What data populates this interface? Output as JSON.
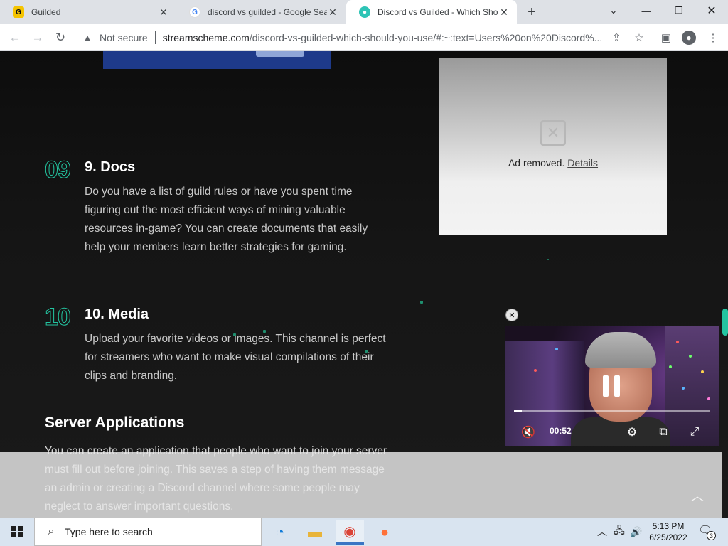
{
  "browser": {
    "tabs": [
      {
        "title": "Guilded",
        "favicon": "guilded-icon",
        "favicon_color": "#f5c400"
      },
      {
        "title": "discord vs guilded - Google Search",
        "favicon": "google-icon",
        "favicon_color": "#4285f4"
      },
      {
        "title": "Discord vs Guilded - Which Should You Use",
        "favicon": "streamscheme-icon",
        "favicon_color": "#2ec4b6",
        "active": true
      }
    ],
    "new_tab_label": "+",
    "security_label": "Not secure",
    "url_host": "streamscheme.com",
    "url_path": "/discord-vs-guilded-which-should-you-use/#:~:text=Users%20on%20Discord%..."
  },
  "page": {
    "ad": {
      "text": "Ad removed.",
      "details_link": "Details"
    },
    "sections": [
      {
        "number": "09",
        "heading": "9. Docs",
        "body": "Do you have a list of guild rules or have you spent time figuring out the most efficient ways of mining valuable resources in-game? You can create documents that easily help your members learn better strategies for gaming."
      },
      {
        "number": "10",
        "heading": "10. Media",
        "body": "Upload your favorite videos or images. This channel is perfect for streamers who want to make visual compilations of their clips and branding."
      }
    ],
    "server_applications": {
      "heading": "Server Applications",
      "body": "You can create an application that people who want to join your server must fill out before joining. This saves a step of having them message an admin or creating a Discord channel where some people may neglect to answer important questions."
    },
    "video": {
      "time": "00:52",
      "progress_fraction": 0.04
    },
    "accent_color": "#23c4a0"
  },
  "taskbar": {
    "search_placeholder": "Type here to search",
    "time": "5:13 PM",
    "date": "6/25/2022",
    "notification_count": "3"
  }
}
